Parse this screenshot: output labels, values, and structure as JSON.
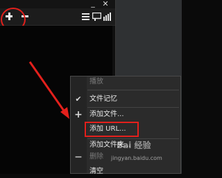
{
  "window": {
    "minimize_icon": "minimize-icon",
    "close_icon": "close-icon"
  },
  "toolbar": {
    "add_icon": "plus-icon",
    "remove_icon": "minus-icon",
    "list_icon": "menu-lines-icon",
    "subtitle_icon": "subtitle-icon",
    "bars_icon": "bars-icon"
  },
  "menu": {
    "items": [
      {
        "label": "播放",
        "enabled": false
      },
      {
        "label": "文件记忆",
        "checked": true
      },
      {
        "label": "添加文件...",
        "icon": "plus-icon"
      },
      {
        "label": "添加 URL..."
      },
      {
        "label": "添加文件夹..."
      },
      {
        "label": "删除",
        "enabled": false,
        "icon": "minus-icon"
      },
      {
        "label": "清空"
      }
    ]
  },
  "watermark": {
    "text": "Bai 经验",
    "url": "jingyan.baidu.com"
  },
  "colors": {
    "annotation_red": "#e3201c",
    "menu_bg": "#2b2b2b",
    "player_bg": "#0a0a0a"
  }
}
